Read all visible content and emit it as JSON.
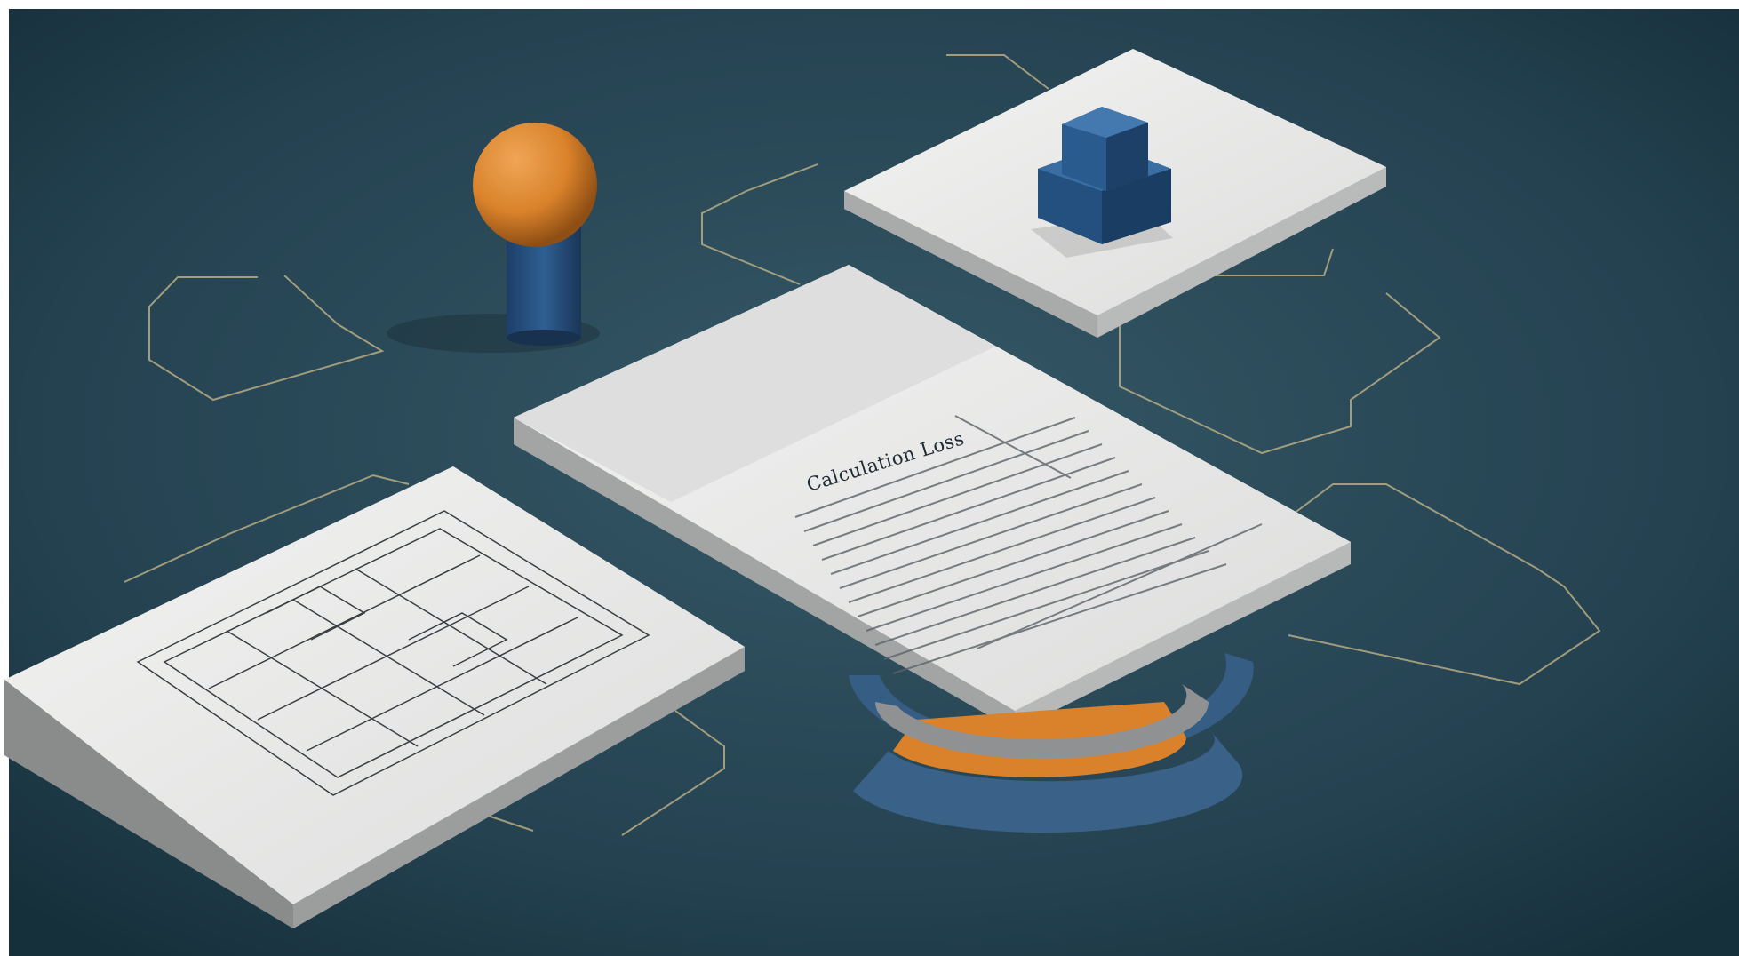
{
  "image": {
    "document_title": "Calculation Loss",
    "colors": {
      "background": "#2c4a58",
      "background_dark": "#1a2e38",
      "paper": "#e9eaea",
      "paper_edge": "#bfc1c1",
      "accent_orange": "#d9822b",
      "accent_blue": "#2c5a8a",
      "gray_ring": "#8a8c8c",
      "circuit_line": "#c9b98a"
    },
    "objects": [
      "orange-sphere-on-blue-cylinder",
      "blue-stacked-cubes-on-slab",
      "floorplan-sheet",
      "text-document-sheet",
      "orange-gray-blue-ring-segment",
      "circuit-lines"
    ]
  }
}
